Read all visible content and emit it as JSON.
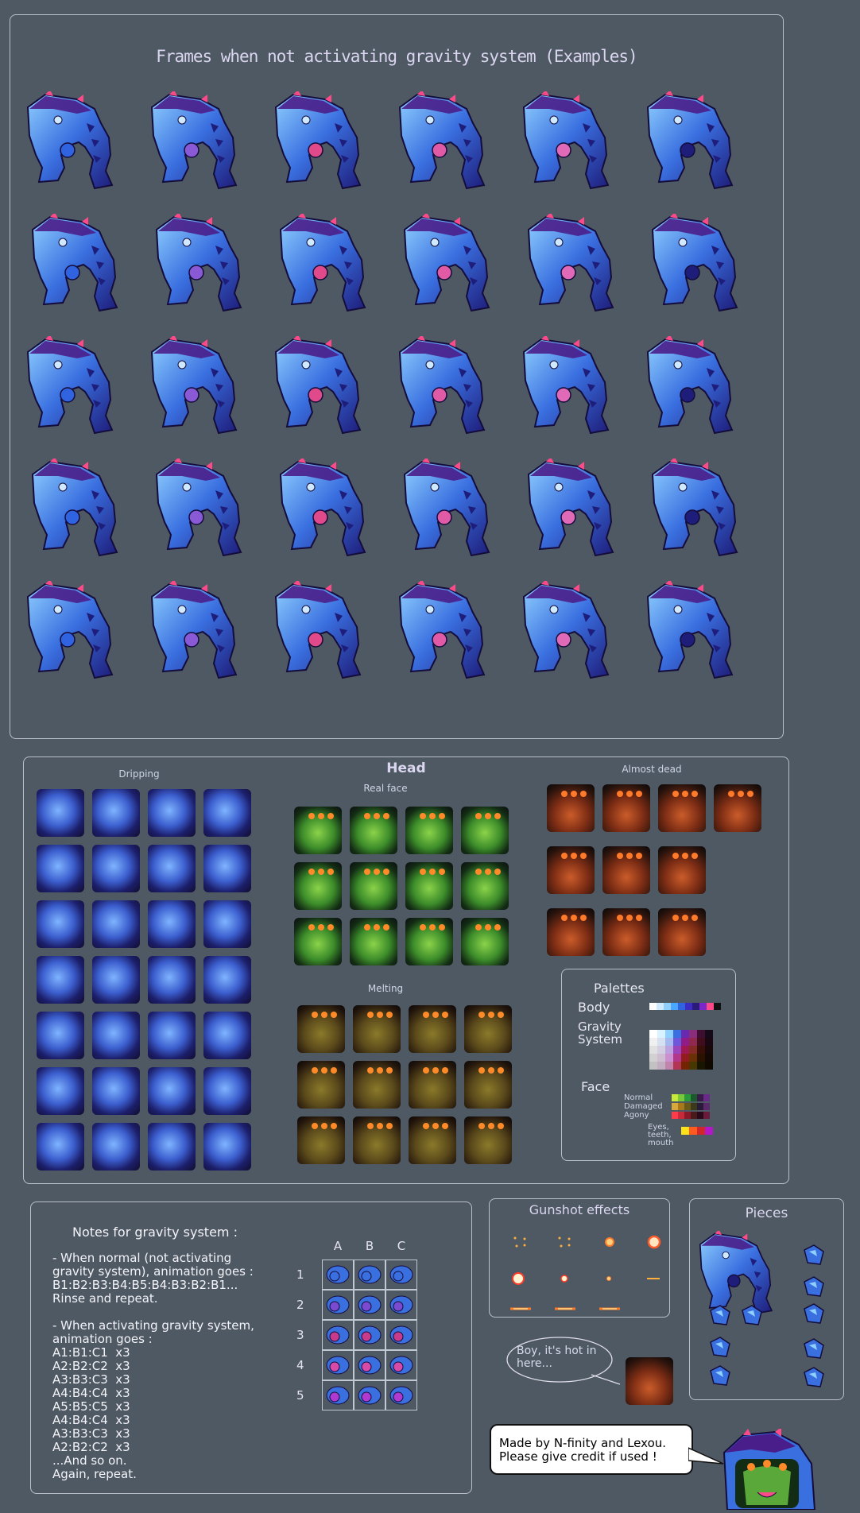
{
  "frames": {
    "title": "Frames when not activating gravity system (Examples)",
    "rows": 5,
    "cols": 6
  },
  "head": {
    "title": "Head",
    "dripping": "Dripping",
    "real_face": "Real face",
    "melting": "Melting",
    "almost_dead": "Almost dead"
  },
  "palettes": {
    "title": "Palettes",
    "body_label": "Body",
    "gravity_label": "Gravity System",
    "face_label": "Face",
    "face_rows": [
      "Normal",
      "Damaged",
      "Agony"
    ],
    "eyes_label": "Eyes, teeth, mouth",
    "body_colors": [
      "#ffffff",
      "#cfe9ff",
      "#8fd0ff",
      "#49a7ff",
      "#2f63e0",
      "#3b2dc1",
      "#2a1a7a",
      "#7b28c8",
      "#ff4a8a",
      "#111111"
    ],
    "gravity_colors": [
      "#ffffff",
      "#d8f3ff",
      "#8fd0ff",
      "#3a6fe0",
      "#6a2ab0",
      "#8a2d7a",
      "#3d0e2f",
      "#160918"
    ],
    "eyes_colors": [
      "#ffe31a",
      "#ff5a20",
      "#d0282a",
      "#b318c8"
    ]
  },
  "notes": {
    "title": "Notes for gravity system :",
    "body": "- When normal (not activating\ngravity system), animation goes :\nB1:B2:B3:B4:B5:B4:B3:B2:B1...\nRinse and repeat.\n\n- When activating gravity system,\nanimation goes :\nA1:B1:C1  x3\nA2:B2:C2  x3\nA3:B3:C3  x3\nA4:B4:C4  x3\nA5:B5:C5  x3\nA4:B4:C4  x3\nA3:B3:C3  x3\nA2:B2:C2  x3\n...And so on.\nAgain, repeat.",
    "columns": [
      "A",
      "B",
      "C"
    ],
    "rows": [
      "1",
      "2",
      "3",
      "4",
      "5"
    ]
  },
  "gunshot": {
    "title": "Gunshot effects"
  },
  "pieces": {
    "title": "Pieces"
  },
  "speech": {
    "hot": "Boy, it's hot in here..."
  },
  "credit": {
    "text": "Made by N-finity and Lexou.\nPlease give credit if used !"
  }
}
